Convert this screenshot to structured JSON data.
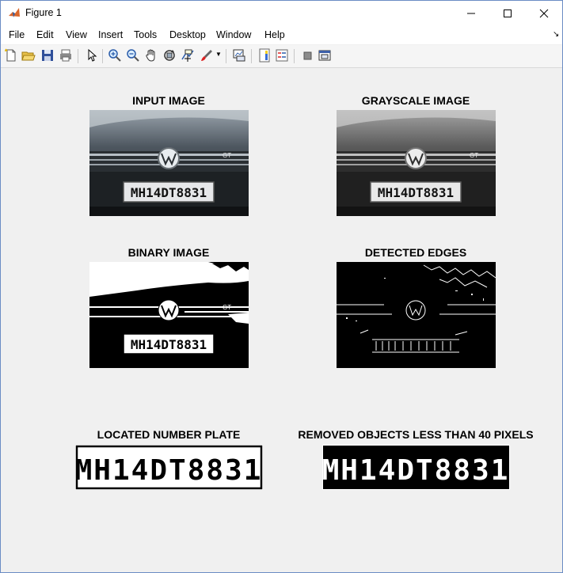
{
  "window": {
    "title": "Figure 1"
  },
  "menu": [
    "File",
    "Edit",
    "View",
    "Insert",
    "Tools",
    "Desktop",
    "Window",
    "Help"
  ],
  "toolbar": {
    "icons": [
      "new-figure-icon",
      "open-file-icon",
      "save-icon",
      "print-icon",
      "pointer-icon",
      "zoom-in-icon",
      "zoom-out-icon",
      "pan-icon",
      "rotate-3d-icon",
      "data-cursor-icon",
      "brush-icon",
      "link-plot-icon",
      "colorbar-icon",
      "legend-icon",
      "hide-plot-tools-icon",
      "show-plot-tools-icon"
    ]
  },
  "panels": {
    "input": {
      "title": "INPUT IMAGE",
      "plate": "MH14DT8831",
      "badge": "GT"
    },
    "grayscale": {
      "title": "GRAYSCALE IMAGE",
      "plate": "MH14DT8831",
      "badge": "GT"
    },
    "binary": {
      "title": "BINARY IMAGE",
      "plate": "MH14DT8831",
      "badge": "GT"
    },
    "edges": {
      "title": "DETECTED EDGES"
    },
    "located": {
      "title": "LOCATED NUMBER PLATE",
      "plate": "MH14DT8831"
    },
    "removed": {
      "title": "REMOVED OBJECTS LESS THAN 40 PIXELS",
      "plate": "MH14DT8831"
    }
  },
  "colors": {
    "window_bg": "#f0f0f0",
    "title_bar": "#ffffff",
    "figure_bg": "#f0f0f0"
  }
}
